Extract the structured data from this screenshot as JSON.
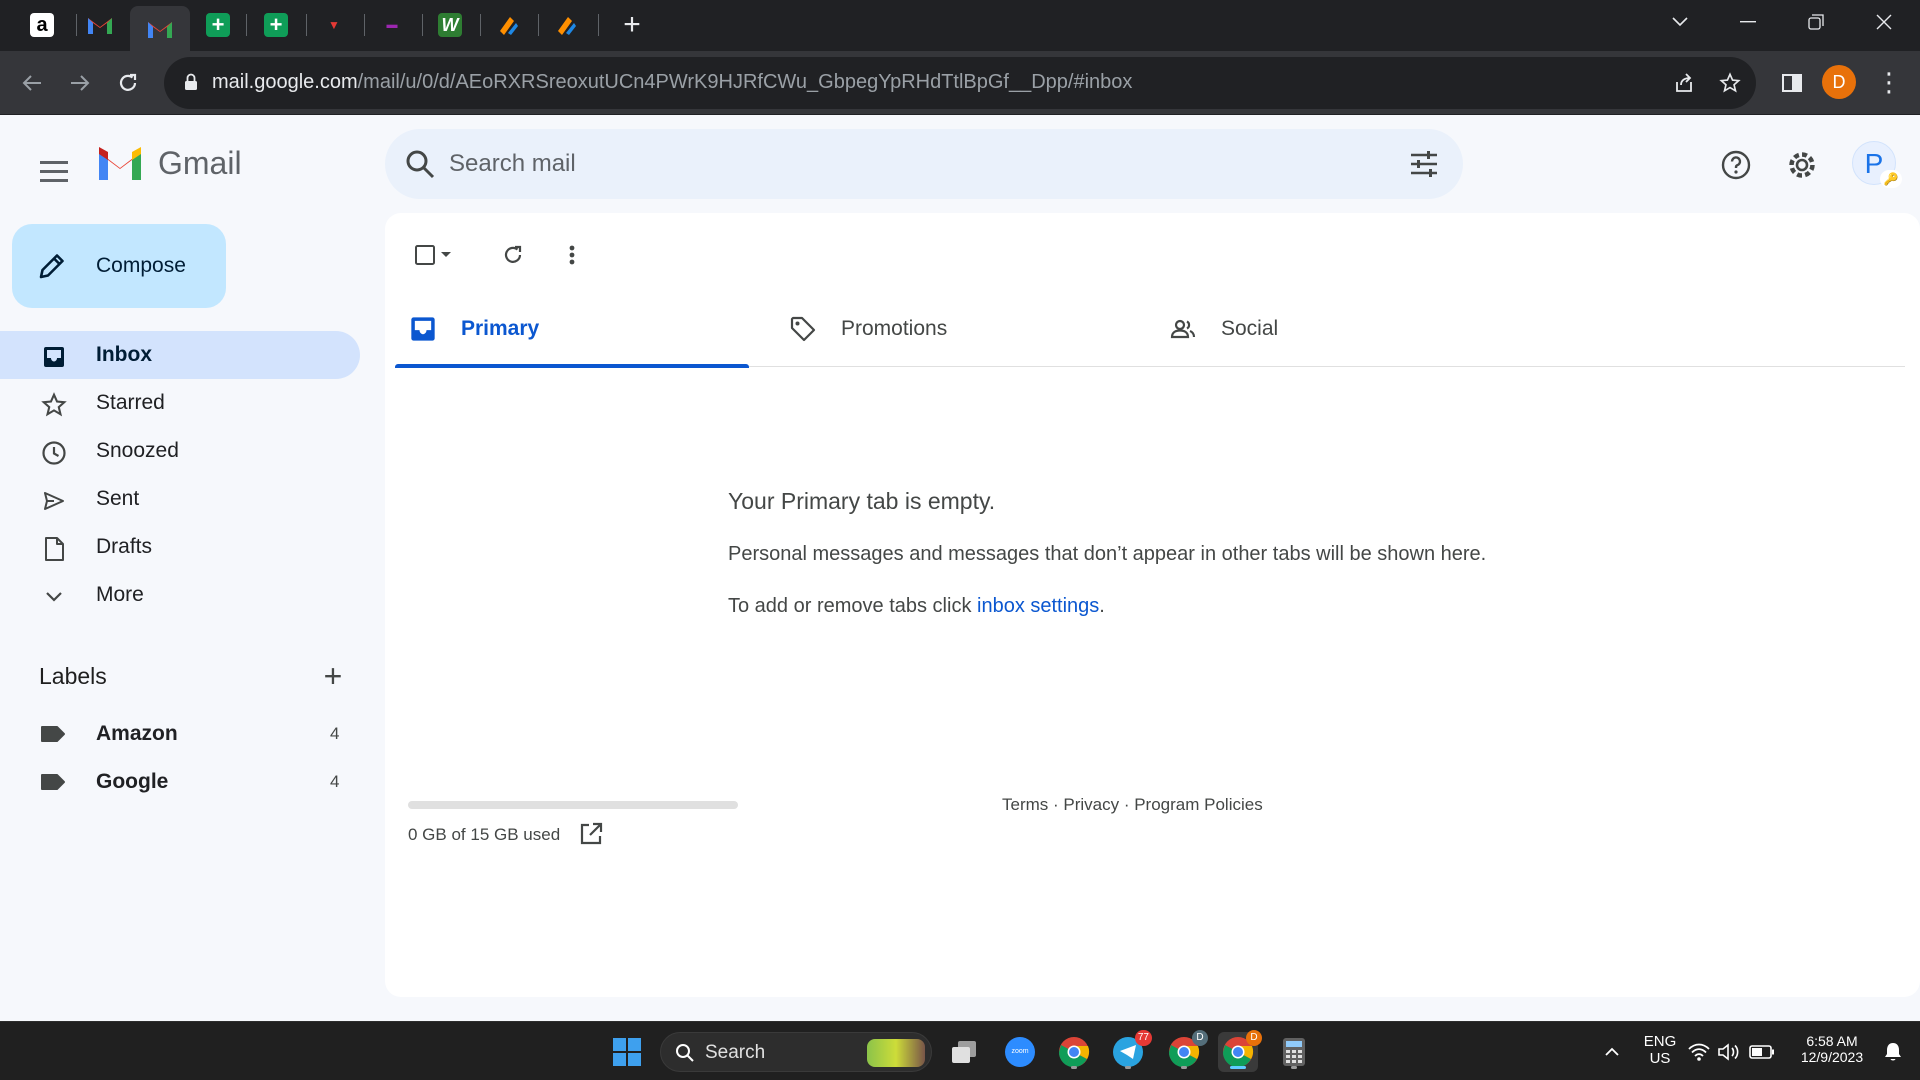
{
  "browser": {
    "tabs": [
      {
        "icon": "amazon-favicon",
        "active": false
      },
      {
        "icon": "gmail-favicon",
        "active": false
      },
      {
        "icon": "gmail-favicon",
        "active": true
      },
      {
        "icon": "sheets-favicon",
        "active": false
      },
      {
        "icon": "sheets-favicon",
        "active": false
      },
      {
        "icon": "red-logo-favicon",
        "active": false
      },
      {
        "icon": "purple-logo-favicon",
        "active": false
      },
      {
        "icon": "w-logo-favicon",
        "active": false
      },
      {
        "icon": "orange-tool-favicon",
        "active": false
      },
      {
        "icon": "orange-tool-favicon",
        "active": false
      }
    ],
    "new_tab_label": "+",
    "url_host": "mail.google.com",
    "url_path": "/mail/u/0/d/AEoRXRSreoxutUCn4PWrK9HJRfCWu_GbpegYpRHdTtlBpGf__Dpp/#inbox",
    "profile_initial": "D"
  },
  "gmail": {
    "logo_text": "Gmail",
    "search_placeholder": "Search mail",
    "avatar_initial": "P",
    "compose_label": "Compose",
    "nav": [
      {
        "label": "Inbox",
        "icon": "inbox-icon",
        "active": true
      },
      {
        "label": "Starred",
        "icon": "star-icon",
        "active": false
      },
      {
        "label": "Snoozed",
        "icon": "clock-icon",
        "active": false
      },
      {
        "label": "Sent",
        "icon": "send-icon",
        "active": false
      },
      {
        "label": "Drafts",
        "icon": "draft-icon",
        "active": false
      },
      {
        "label": "More",
        "icon": "chevron-down-icon",
        "active": false
      }
    ],
    "labels_heading": "Labels",
    "labels": [
      {
        "name": "Amazon",
        "count": "4"
      },
      {
        "name": "Google",
        "count": "4"
      }
    ],
    "category_tabs": [
      {
        "label": "Primary",
        "icon": "inbox-tab-icon",
        "active": true
      },
      {
        "label": "Promotions",
        "icon": "tag-icon",
        "active": false
      },
      {
        "label": "Social",
        "icon": "people-icon",
        "active": false
      }
    ],
    "empty_title": "Your Primary tab is empty.",
    "empty_desc": "Personal messages and messages that don’t appear in other tabs will be shown here.",
    "empty_settings_prefix": "To add or remove tabs click ",
    "empty_settings_link": "inbox settings",
    "empty_settings_suffix": ".",
    "storage_text": "0 GB of 15 GB used",
    "storage_fraction": 0.0,
    "footer_links": "Terms · Privacy · Program Policies"
  },
  "taskbar": {
    "search_label": "Search",
    "language_top": "ENG",
    "language_bottom": "US",
    "time": "6:58 AM",
    "date": "12/9/2023",
    "telegram_badge": "77",
    "chrome_badge_1": "D",
    "chrome_badge_2": "D"
  },
  "colors": {
    "accent": "#0b57d0",
    "compose_bg": "#c2e7ff",
    "active_nav_bg": "#d3e3fd",
    "search_bg": "#eaf1fb",
    "page_bg": "#f6f8fc"
  }
}
